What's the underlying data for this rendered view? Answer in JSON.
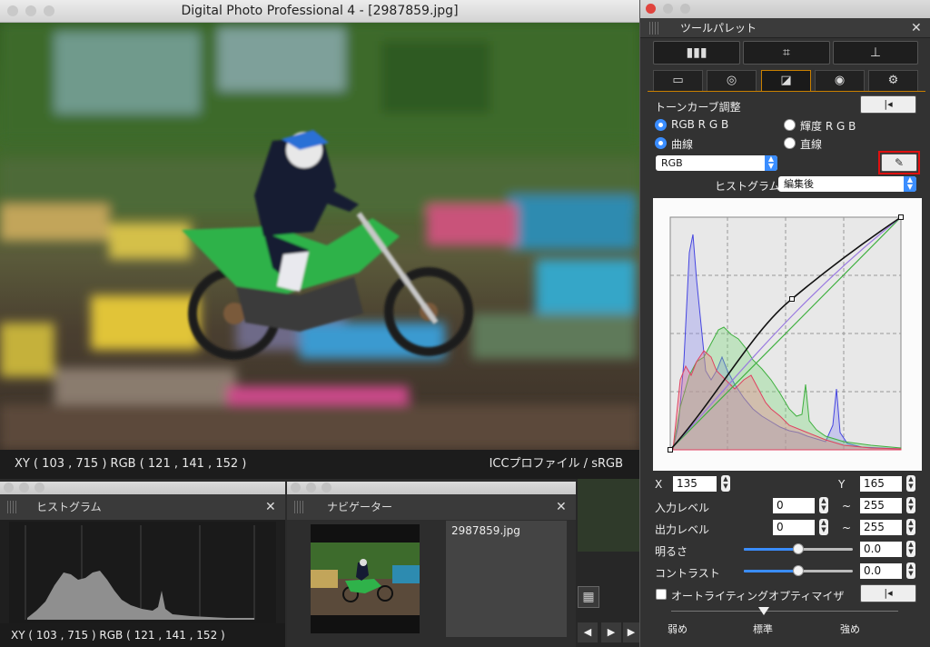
{
  "main_window": {
    "title": "Digital Photo Professional 4 - [2987859.jpg]",
    "status_left": "XY (        103 ,        715  )  RGB (    121 ,    141 ,    152  )",
    "status_right": "ICCプロファイル / sRGB"
  },
  "palette": {
    "title": "ツールパレット",
    "top_buttons": [
      "▮▮▮",
      "⌗",
      "⊥"
    ],
    "tabs": [
      "▭",
      "◎",
      "◪",
      "◉",
      "⚙"
    ],
    "section_title": "トーンカーブ調整",
    "reset_label": "|◂",
    "radio_rgb": "RGB R G B",
    "radio_luma": "輝度 R G B",
    "radio_curve": "曲線",
    "radio_linear": "直線",
    "channel_select": "RGB",
    "histogram_label": "ヒストグラム",
    "histogram_select": "編集後",
    "x_label": "X",
    "x_value": "135",
    "y_label": "Y",
    "y_value": "165",
    "input_level_label": "入力レベル",
    "input_level_min": "0",
    "input_level_max": "255",
    "output_level_label": "出力レベル",
    "output_level_min": "0",
    "output_level_max": "255",
    "tilde": "~",
    "brightness_label": "明るさ",
    "brightness_value": "0.0",
    "contrast_label": "コントラスト",
    "contrast_value": "0.0",
    "auto_lighting_label": "オートライティングオプティマイザ",
    "auto_low": "弱め",
    "auto_std": "標準",
    "auto_high": "強め",
    "brightness_level": 0.5,
    "contrast_level": 0.5
  },
  "histogram_window": {
    "title": "ヒストグラム",
    "status": "XY (      103 ,       715  )  RGB (    121 ,    141 ,    152  )"
  },
  "navigator_window": {
    "title": "ナビゲーター",
    "filename": "2987859.jpg"
  },
  "colors": {
    "accent": "#3a8dff",
    "tab_active_border": "#c98000",
    "highlight_red": "#e01010"
  }
}
